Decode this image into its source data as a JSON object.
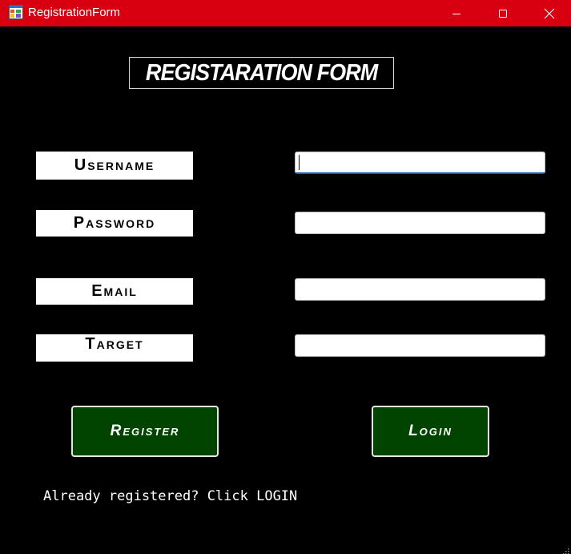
{
  "window": {
    "title": "RegistrationForm",
    "icon": "app-window-icon",
    "controls": {
      "minimize_icon": "minimize-icon",
      "maximize_icon": "maximize-icon",
      "close_icon": "close-icon"
    },
    "colors": {
      "titlebar": "#d80010",
      "background": "#000000"
    }
  },
  "form": {
    "heading": "REGISTARATION FORM",
    "fields": {
      "username": {
        "label": "Username",
        "value": ""
      },
      "password": {
        "label": "Password",
        "value": ""
      },
      "email": {
        "label": "Email",
        "value": ""
      },
      "target": {
        "label": "Target",
        "value": ""
      }
    },
    "buttons": {
      "register": "Register",
      "login": "Login",
      "color": "#004400"
    },
    "hint": "Already registered? Click LOGIN"
  }
}
